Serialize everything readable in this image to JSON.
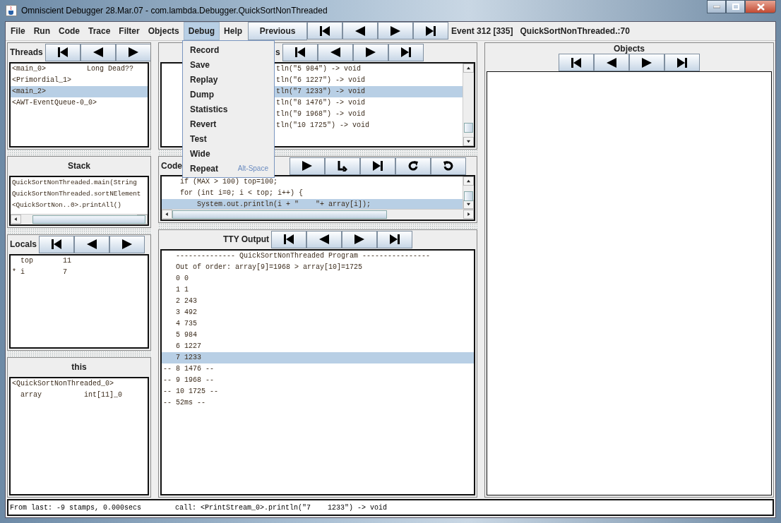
{
  "window": {
    "title": "Omniscient Debugger 28.Mar.07 - com.lambda.Debugger.QuickSortNonThreaded"
  },
  "menu": [
    {
      "label": "File",
      "selected": false
    },
    {
      "label": "Run",
      "selected": false
    },
    {
      "label": "Code",
      "selected": false
    },
    {
      "label": "Trace",
      "selected": false
    },
    {
      "label": "Filter",
      "selected": false
    },
    {
      "label": "Objects",
      "selected": false
    },
    {
      "label": "Debug",
      "selected": true
    },
    {
      "label": "Help",
      "selected": false
    }
  ],
  "toolbar": {
    "previous": "Previous",
    "nav": [
      {
        "kind": "first"
      },
      {
        "kind": "prev"
      },
      {
        "kind": "next"
      },
      {
        "kind": "last"
      }
    ],
    "event": "Event 312 [335]",
    "location": "QuickSortNonThreaded.:70"
  },
  "debug_menu": [
    {
      "label": "Record"
    },
    {
      "label": "Save"
    },
    {
      "label": "Replay"
    },
    {
      "label": "Dump"
    },
    {
      "label": "Statistics"
    },
    {
      "label": "Revert"
    },
    {
      "label": "Test"
    },
    {
      "label": "Wide"
    },
    {
      "label": "Repeat",
      "shortcut": "Alt-Space"
    }
  ],
  "threads": {
    "title": "Threads",
    "nav": [
      {
        "kind": "first"
      },
      {
        "kind": "prev"
      },
      {
        "kind": "next"
      }
    ],
    "rows": [
      {
        "name": "<main_0>",
        "status": "Long Dead??",
        "selected": false
      },
      {
        "name": "<Primordial_1>",
        "selected": false
      },
      {
        "name": "<main_2>",
        "selected": true
      },
      {
        "name": "<AWT-EventQueue-0_0>",
        "selected": false
      }
    ]
  },
  "stack": {
    "title": "Stack",
    "rows": [
      "QuickSortNonThreaded.main(String",
      "QuickSortNonThreaded.sortNElement",
      "<QuickSortNon..0>.printAll()"
    ]
  },
  "locals": {
    "title": "Locals",
    "nav": [
      {
        "kind": "first"
      },
      {
        "kind": "prev"
      },
      {
        "kind": "next"
      }
    ],
    "rows": [
      {
        "marker": "",
        "name": "top",
        "value": "11"
      },
      {
        "marker": "*",
        "name": "i",
        "value": "7"
      }
    ]
  },
  "this": {
    "title": "this",
    "object": "<QuickSortNonThreaded_0>",
    "rows": [
      {
        "name": "array",
        "value": "int[11]_0"
      }
    ]
  },
  "trace": {
    "title": "s",
    "nav": [
      {
        "kind": "first"
      },
      {
        "kind": "prev"
      },
      {
        "kind": "next"
      },
      {
        "kind": "last"
      }
    ],
    "rows": [
      {
        "text": "tln(\"5 984\") -> void",
        "selected": false
      },
      {
        "text": "tln(\"6 1227\") -> void",
        "selected": false
      },
      {
        "text": "tln(\"7 1233\") -> void",
        "selected": true
      },
      {
        "text": "tln(\"8 1476\") -> void",
        "selected": false
      },
      {
        "text": "tln(\"9 1968\") -> void",
        "selected": false
      },
      {
        "text": "tln(\"10 1725\") -> void",
        "selected": false
      }
    ]
  },
  "code": {
    "title": "Code",
    "nav": [
      {
        "kind": "next"
      },
      {
        "kind": "step_in"
      },
      {
        "kind": "last"
      },
      {
        "kind": "redo"
      },
      {
        "kind": "undo"
      }
    ],
    "rows": [
      {
        "text": "    if (MAX > 100) top=100;",
        "selected": false
      },
      {
        "text": "    for (int i=0; i < top; i++) {",
        "selected": false
      },
      {
        "text": "        System.out.println(i + \"    \"+ array[i]);",
        "selected": true
      }
    ]
  },
  "tty": {
    "title": "TTY Output",
    "nav": [
      {
        "kind": "first"
      },
      {
        "kind": "prev"
      },
      {
        "kind": "next"
      },
      {
        "kind": "last"
      }
    ],
    "rows": [
      {
        "text": "   -------------- QuickSortNonThreaded Program ----------------",
        "selected": false
      },
      {
        "text": "   Out of order: array[9]=1968 > array[10]=1725",
        "selected": false
      },
      {
        "text": "   0 0",
        "selected": false
      },
      {
        "text": "   1 1",
        "selected": false
      },
      {
        "text": "   2 243",
        "selected": false
      },
      {
        "text": "   3 492",
        "selected": false
      },
      {
        "text": "   4 735",
        "selected": false
      },
      {
        "text": "   5 984",
        "selected": false
      },
      {
        "text": "   6 1227",
        "selected": false
      },
      {
        "text": "   7 1233",
        "selected": true
      },
      {
        "text": "-- 8 1476 --",
        "selected": false
      },
      {
        "text": "-- 9 1968 --",
        "selected": false
      },
      {
        "text": "-- 10 1725 --",
        "selected": false
      },
      {
        "text": "-- 52ms --",
        "selected": false
      }
    ]
  },
  "objects": {
    "title": "Objects",
    "nav": [
      {
        "kind": "first"
      },
      {
        "kind": "prev"
      },
      {
        "kind": "next"
      },
      {
        "kind": "last"
      }
    ]
  },
  "status_bar": {
    "timing": "From last: -9 stamps, 0.000secs",
    "call": "call: <PrintStream_0>.println(\"7    1233\") -> void"
  }
}
